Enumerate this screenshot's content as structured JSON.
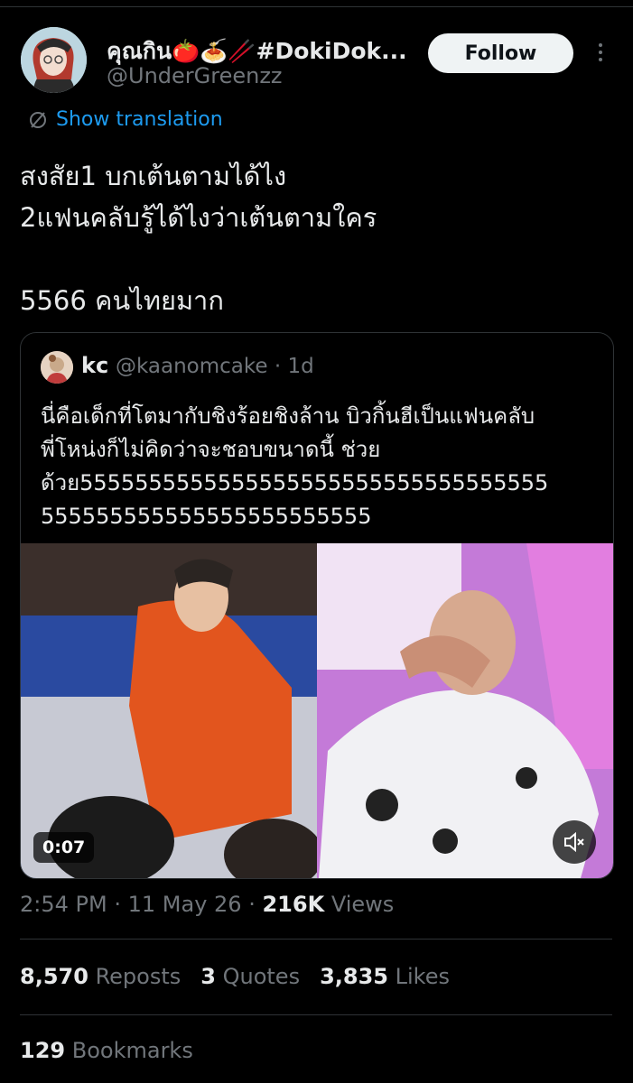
{
  "author": {
    "display_name": "คุณกิน🍅🍝🥢#DokiDok...",
    "handle": "@UnderGreenzz"
  },
  "follow_label": "Follow",
  "translate_label": "Show translation",
  "tweet_text": "สงสัย1 บกเต้นตามได้ไง\n2แฟนคลับรู้ได้ไงว่าเต้นตามใคร\n\n5566 คนไทยมาก",
  "quote": {
    "name": "kc",
    "handle_time": "@kaanomcake · 1d",
    "text": "นี่คือเด็กที่โตมากับชิงร้อยชิงล้าน บิวกิ้นฮีเป็นแฟนคลับ\nพี่โหน่งก็ไม่คิดว่าจะชอบขนาดนี้ ช่วย\nด้วย5555555555555555555555555555555555\n555555555555555555555555",
    "video_duration": "0:07"
  },
  "meta": {
    "time": "2:54 PM",
    "date": "11 May 26",
    "views_count": "216K",
    "views_label": "Views"
  },
  "stats": {
    "reposts_count": "8,570",
    "reposts_label": "Reposts",
    "quotes_count": "3",
    "quotes_label": "Quotes",
    "likes_count": "3,835",
    "likes_label": "Likes",
    "bookmarks_count": "129",
    "bookmarks_label": "Bookmarks"
  },
  "colors": {
    "background": "#000000",
    "text": "#e7e9ea",
    "muted": "#71767b",
    "link": "#1d9bf0",
    "border": "#2f3336"
  }
}
